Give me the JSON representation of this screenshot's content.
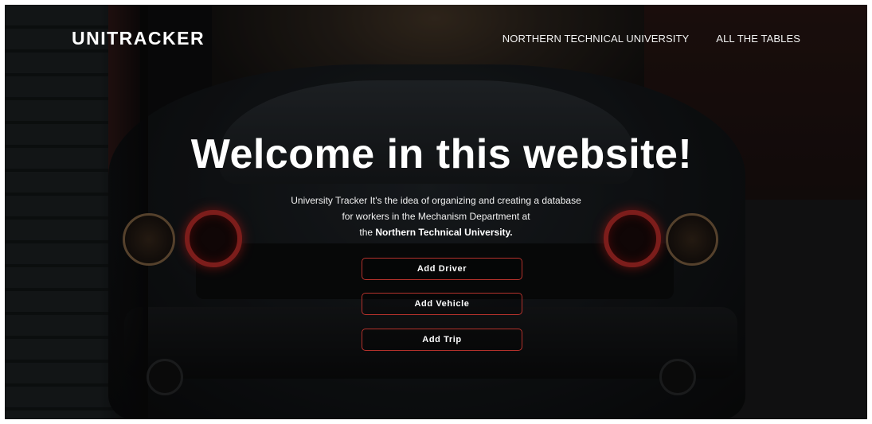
{
  "header": {
    "brand": "UNITRACKER",
    "nav": [
      {
        "label": "NORTHERN TECHNICAL UNIVERSITY"
      },
      {
        "label": "ALL THE TABLES"
      }
    ]
  },
  "hero": {
    "title": "Welcome in this website!",
    "description_line1": "University Tracker It's the idea of organizing and creating a database",
    "description_line2": "for workers in the Mechanism Department at",
    "description_line3_prefix": "the ",
    "description_line3_bold": "Northern Technical University."
  },
  "actions": [
    {
      "label": "Add Driver"
    },
    {
      "label": "Add Vehicle"
    },
    {
      "label": "Add Trip"
    }
  ],
  "colors": {
    "button_border": "#b5322c",
    "text": "#ffffff"
  }
}
